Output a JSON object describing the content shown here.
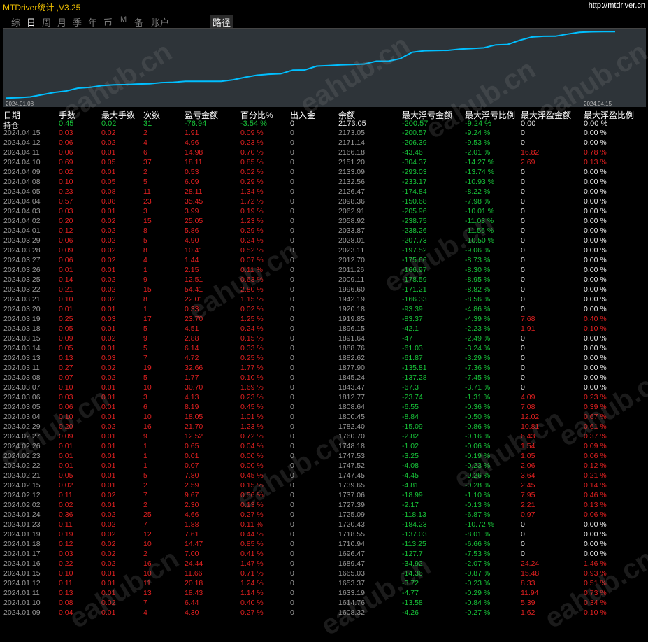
{
  "app": {
    "title": "MTDriver统计 ,V3.25",
    "url": "http://mtdriver.cn"
  },
  "nav": [
    "综",
    "日",
    "周",
    "月",
    "季",
    "年",
    "币",
    "M",
    "备",
    "账户"
  ],
  "nav_active": "日",
  "nav_path": "路径",
  "chart": {
    "x_start": "2024.01.08",
    "x_end": "2024.04.15",
    "line_color": "#00bfff"
  },
  "chart_data": {
    "type": "line",
    "x": [
      "2024.01.08",
      "2024.01.09",
      "2024.01.10",
      "2024.01.11",
      "2024.01.12",
      "2024.01.15",
      "2024.01.16",
      "2024.01.17",
      "2024.01.18",
      "2024.01.19",
      "2024.01.23",
      "2024.01.24",
      "2024.02.02",
      "2024.02.12",
      "2024.02.15",
      "2024.02.21",
      "2024.02.22",
      "2024.02.23",
      "2024.02.26",
      "2024.02.27",
      "2024.02.29",
      "2024.03.04",
      "2024.03.05",
      "2024.03.06",
      "2024.03.07",
      "2024.03.08",
      "2024.03.11",
      "2024.03.12",
      "2024.03.13",
      "2024.03.14",
      "2024.03.15",
      "2024.03.18",
      "2024.03.19",
      "2024.03.20",
      "2024.03.21",
      "2024.03.22",
      "2024.03.25",
      "2024.03.26",
      "2024.03.27",
      "2024.03.28",
      "2024.03.29",
      "2024.04.01",
      "2024.04.02",
      "2024.04.03",
      "2024.04.04",
      "2024.04.05",
      "2024.04.08",
      "2024.04.09",
      "2024.04.10",
      "2024.04.11",
      "2024.04.12",
      "2024.04.15"
    ],
    "y": [
      1604.02,
      1608.32,
      1614.76,
      1633.19,
      1653.37,
      1665.03,
      1689.47,
      1696.47,
      1710.94,
      1718.55,
      1720.43,
      1725.09,
      1727.39,
      1737.06,
      1739.65,
      1747.45,
      1747.52,
      1747.53,
      1748.18,
      1760.7,
      1782.4,
      1800.45,
      1808.64,
      1812.77,
      1843.47,
      1845.24,
      1877.9,
      1882.62,
      1888.76,
      1891.64,
      1896.15,
      1919.85,
      1920.18,
      1942.19,
      1996.6,
      2009.11,
      2011.26,
      2012.7,
      2023.11,
      2028.01,
      2033.87,
      2058.92,
      2062.91,
      2098.36,
      2126.47,
      2132.56,
      2133.09,
      2151.2,
      2166.18,
      2171.14,
      2173.05,
      2173.05
    ],
    "ylim": [
      1600,
      2180
    ]
  },
  "table": {
    "headers": [
      "日期",
      "手数",
      "最大手数",
      "次数",
      "盈亏金额",
      "百分比%",
      "出入金",
      "余额",
      "最大浮亏金额",
      "最大浮亏比例",
      "最大浮盈金额",
      "最大浮盈比例"
    ],
    "hold": [
      "持仓",
      "0.45",
      "0.02",
      "31",
      "-76.94",
      "-3.54 %",
      "0",
      "2173.05",
      "-200.57",
      "-9.24 %",
      "0.00",
      "0.00 %"
    ],
    "rows": [
      [
        "2024.04.15",
        "0.03",
        "0.02",
        "2",
        "1.91",
        "0.09 %",
        "0",
        "2173.05",
        "-200.57",
        "-9.24 %",
        "0",
        "0.00 %"
      ],
      [
        "2024.04.12",
        "0.06",
        "0.02",
        "4",
        "4.96",
        "0.23 %",
        "0",
        "2171.14",
        "-206.39",
        "-9.53 %",
        "0",
        "0.00 %"
      ],
      [
        "2024.04.11",
        "0.06",
        "0.01",
        "6",
        "14.98",
        "0.70 %",
        "0",
        "2166.18",
        "-43.46",
        "-2.01 %",
        "16.82",
        "0.78 %"
      ],
      [
        "2024.04.10",
        "0.69",
        "0.05",
        "37",
        "18.11",
        "0.85 %",
        "0",
        "2151.20",
        "-304.37",
        "-14.27 %",
        "2.69",
        "0.13 %"
      ],
      [
        "2024.04.09",
        "0.02",
        "0.01",
        "2",
        "0.53",
        "0.02 %",
        "0",
        "2133.09",
        "-293.03",
        "-13.74 %",
        "0",
        "0.00 %"
      ],
      [
        "2024.04.08",
        "0.10",
        "0.05",
        "5",
        "6.09",
        "0.29 %",
        "0",
        "2132.56",
        "-233.17",
        "-10.93 %",
        "0",
        "0.00 %"
      ],
      [
        "2024.04.05",
        "0.23",
        "0.08",
        "11",
        "28.11",
        "1.34 %",
        "0",
        "2126.47",
        "-174.84",
        "-8.22 %",
        "0",
        "0.00 %"
      ],
      [
        "2024.04.04",
        "0.57",
        "0.08",
        "23",
        "35.45",
        "1.72 %",
        "0",
        "2098.36",
        "-150.68",
        "-7.98 %",
        "0",
        "0.00 %"
      ],
      [
        "2024.04.03",
        "0.03",
        "0.01",
        "3",
        "3.99",
        "0.19 %",
        "0",
        "2062.91",
        "-205.96",
        "-10.01 %",
        "0",
        "0.00 %"
      ],
      [
        "2024.04.02",
        "0.20",
        "0.02",
        "15",
        "25.05",
        "1.23 %",
        "0",
        "2058.92",
        "-238.75",
        "-11.03 %",
        "0",
        "0.00 %"
      ],
      [
        "2024.04.01",
        "0.12",
        "0.02",
        "8",
        "5.86",
        "0.29 %",
        "0",
        "2033.87",
        "-238.26",
        "-11.56 %",
        "0",
        "0.00 %"
      ],
      [
        "2024.03.29",
        "0.06",
        "0.02",
        "5",
        "4.90",
        "0.24 %",
        "0",
        "2028.01",
        "-207.73",
        "-10.50 %",
        "0",
        "0.00 %"
      ],
      [
        "2024.03.28",
        "0.09",
        "0.02",
        "8",
        "10.41",
        "0.52 %",
        "0",
        "2023.11",
        "-197.52",
        "-9.06 %",
        "0",
        "0.00 %"
      ],
      [
        "2024.03.27",
        "0.06",
        "0.02",
        "4",
        "1.44",
        "0.07 %",
        "0",
        "2012.70",
        "-175.66",
        "-8.73 %",
        "0",
        "0.00 %"
      ],
      [
        "2024.03.26",
        "0.01",
        "0.01",
        "1",
        "2.15",
        "0.11 %",
        "0",
        "2011.26",
        "-166.97",
        "-8.30 %",
        "0",
        "0.00 %"
      ],
      [
        "2024.03.25",
        "0.14",
        "0.02",
        "9",
        "12.51",
        "0.63 %",
        "0",
        "2009.11",
        "-178.59",
        "-8.95 %",
        "0",
        "0.00 %"
      ],
      [
        "2024.03.22",
        "0.21",
        "0.02",
        "15",
        "54.41",
        "2.80 %",
        "0",
        "1996.60",
        "-171.21",
        "-8.82 %",
        "0",
        "0.00 %"
      ],
      [
        "2024.03.21",
        "0.10",
        "0.02",
        "8",
        "22.01",
        "1.15 %",
        "0",
        "1942.19",
        "-166.33",
        "-8.56 %",
        "0",
        "0.00 %"
      ],
      [
        "2024.03.20",
        "0.01",
        "0.01",
        "1",
        "0.33",
        "0.02 %",
        "0",
        "1920.18",
        "-93.39",
        "-4.86 %",
        "0",
        "0.00 %"
      ],
      [
        "2024.03.19",
        "0.25",
        "0.03",
        "17",
        "23.70",
        "1.25 %",
        "0",
        "1919.85",
        "-83.37",
        "-4.39 %",
        "7.68",
        "0.40 %"
      ],
      [
        "2024.03.18",
        "0.05",
        "0.01",
        "5",
        "4.51",
        "0.24 %",
        "0",
        "1896.15",
        "-42.1",
        "-2.23 %",
        "1.91",
        "0.10 %"
      ],
      [
        "2024.03.15",
        "0.09",
        "0.02",
        "9",
        "2.88",
        "0.15 %",
        "0",
        "1891.64",
        "-47",
        "-2.49 %",
        "0",
        "0.00 %"
      ],
      [
        "2024.03.14",
        "0.05",
        "0.01",
        "5",
        "6.14",
        "0.33 %",
        "0",
        "1888.76",
        "-61.03",
        "-3.24 %",
        "0",
        "0.00 %"
      ],
      [
        "2024.03.13",
        "0.13",
        "0.03",
        "7",
        "4.72",
        "0.25 %",
        "0",
        "1882.62",
        "-61.87",
        "-3.29 %",
        "0",
        "0.00 %"
      ],
      [
        "2024.03.11",
        "0.27",
        "0.02",
        "19",
        "32.66",
        "1.77 %",
        "0",
        "1877.90",
        "-135.81",
        "-7.36 %",
        "0",
        "0.00 %"
      ],
      [
        "2024.03.08",
        "0.07",
        "0.02",
        "5",
        "1.77",
        "0.10 %",
        "0",
        "1845.24",
        "-137.28",
        "-7.45 %",
        "0",
        "0.00 %"
      ],
      [
        "2024.03.07",
        "0.10",
        "0.01",
        "10",
        "30.70",
        "1.69 %",
        "0",
        "1843.47",
        "-67.3",
        "-3.71 %",
        "0",
        "0.00 %"
      ],
      [
        "2024.03.06",
        "0.03",
        "0.01",
        "3",
        "4.13",
        "0.23 %",
        "0",
        "1812.77",
        "-23.74",
        "-1.31 %",
        "4.09",
        "0.23 %"
      ],
      [
        "2024.03.05",
        "0.06",
        "0.01",
        "6",
        "8.19",
        "0.45 %",
        "0",
        "1808.64",
        "-6.55",
        "-0.36 %",
        "7.08",
        "0.39 %"
      ],
      [
        "2024.03.04",
        "0.10",
        "0.01",
        "10",
        "18.05",
        "1.01 %",
        "0",
        "1800.45",
        "-8.84",
        "-0.50 %",
        "12.02",
        "0.67 %"
      ],
      [
        "2024.02.29",
        "0.20",
        "0.02",
        "16",
        "21.70",
        "1.23 %",
        "0",
        "1782.40",
        "-15.09",
        "-0.86 %",
        "10.81",
        "0.61 %"
      ],
      [
        "2024.02.27",
        "0.09",
        "0.01",
        "9",
        "12.52",
        "0.72 %",
        "0",
        "1760.70",
        "-2.82",
        "-0.16 %",
        "6.43",
        "0.37 %"
      ],
      [
        "2024.02.26",
        "0.01",
        "0.01",
        "1",
        "0.65",
        "0.04 %",
        "0",
        "1748.18",
        "-1.02",
        "-0.06 %",
        "1.54",
        "0.09 %"
      ],
      [
        "2024.02.23",
        "0.01",
        "0.01",
        "1",
        "0.01",
        "0.00 %",
        "0",
        "1747.53",
        "-3.25",
        "-0.19 %",
        "1.05",
        "0.06 %"
      ],
      [
        "2024.02.22",
        "0.01",
        "0.01",
        "1",
        "0.07",
        "0.00 %",
        "0",
        "1747.52",
        "-4.08",
        "-0.23 %",
        "2.06",
        "0.12 %"
      ],
      [
        "2024.02.21",
        "0.05",
        "0.01",
        "5",
        "7.80",
        "0.45 %",
        "0",
        "1747.45",
        "-4.45",
        "-0.26 %",
        "3.64",
        "0.21 %"
      ],
      [
        "2024.02.15",
        "0.02",
        "0.01",
        "2",
        "2.59",
        "0.15 %",
        "0",
        "1739.65",
        "-4.81",
        "-0.28 %",
        "2.45",
        "0.14 %"
      ],
      [
        "2024.02.12",
        "0.11",
        "0.02",
        "7",
        "9.67",
        "0.56 %",
        "0",
        "1737.06",
        "-18.99",
        "-1.10 %",
        "7.95",
        "0.46 %"
      ],
      [
        "2024.02.02",
        "0.02",
        "0.01",
        "2",
        "2.30",
        "0.13 %",
        "0",
        "1727.39",
        "-2.17",
        "-0.13 %",
        "2.21",
        "0.13 %"
      ],
      [
        "2024.01.24",
        "0.36",
        "0.02",
        "25",
        "4.66",
        "0.27 %",
        "0",
        "1725.09",
        "-118.13",
        "-6.87 %",
        "0.97",
        "0.06 %"
      ],
      [
        "2024.01.23",
        "0.11",
        "0.02",
        "7",
        "1.88",
        "0.11 %",
        "0",
        "1720.43",
        "-184.23",
        "-10.72 %",
        "0",
        "0.00 %"
      ],
      [
        "2024.01.19",
        "0.19",
        "0.02",
        "12",
        "7.61",
        "0.44 %",
        "0",
        "1718.55",
        "-137.03",
        "-8.01 %",
        "0",
        "0.00 %"
      ],
      [
        "2024.01.18",
        "0.12",
        "0.02",
        "10",
        "14.47",
        "0.85 %",
        "0",
        "1710.94",
        "-113.25",
        "-6.66 %",
        "0",
        "0.00 %"
      ],
      [
        "2024.01.17",
        "0.03",
        "0.02",
        "2",
        "7.00",
        "0.41 %",
        "0",
        "1696.47",
        "-127.7",
        "-7.53 %",
        "0",
        "0.00 %"
      ],
      [
        "2024.01.16",
        "0.22",
        "0.02",
        "16",
        "24.44",
        "1.47 %",
        "0",
        "1689.47",
        "-34.92",
        "-2.07 %",
        "24.24",
        "1.46 %"
      ],
      [
        "2024.01.15",
        "0.10",
        "0.01",
        "10",
        "11.66",
        "0.71 %",
        "0",
        "1665.03",
        "-14.36",
        "-0.87 %",
        "15.48",
        "0.93 %"
      ],
      [
        "2024.01.12",
        "0.11",
        "0.01",
        "11",
        "20.18",
        "1.24 %",
        "0",
        "1653.37",
        "-3.72",
        "-0.23 %",
        "8.33",
        "0.51 %"
      ],
      [
        "2024.01.11",
        "0.13",
        "0.01",
        "13",
        "18.43",
        "1.14 %",
        "0",
        "1633.19",
        "-4.77",
        "-0.29 %",
        "11.94",
        "0.73 %"
      ],
      [
        "2024.01.10",
        "0.08",
        "0.02",
        "7",
        "6.44",
        "0.40 %",
        "0",
        "1614.76",
        "-13.58",
        "-0.84 %",
        "5.39",
        "0.34 %"
      ],
      [
        "2024.01.09",
        "0.04",
        "0.01",
        "4",
        "4.30",
        "0.27 %",
        "0",
        "1608.32",
        "-4.26",
        "-0.27 %",
        "1.62",
        "0.10 %"
      ]
    ]
  },
  "watermark": "eahub.cn"
}
